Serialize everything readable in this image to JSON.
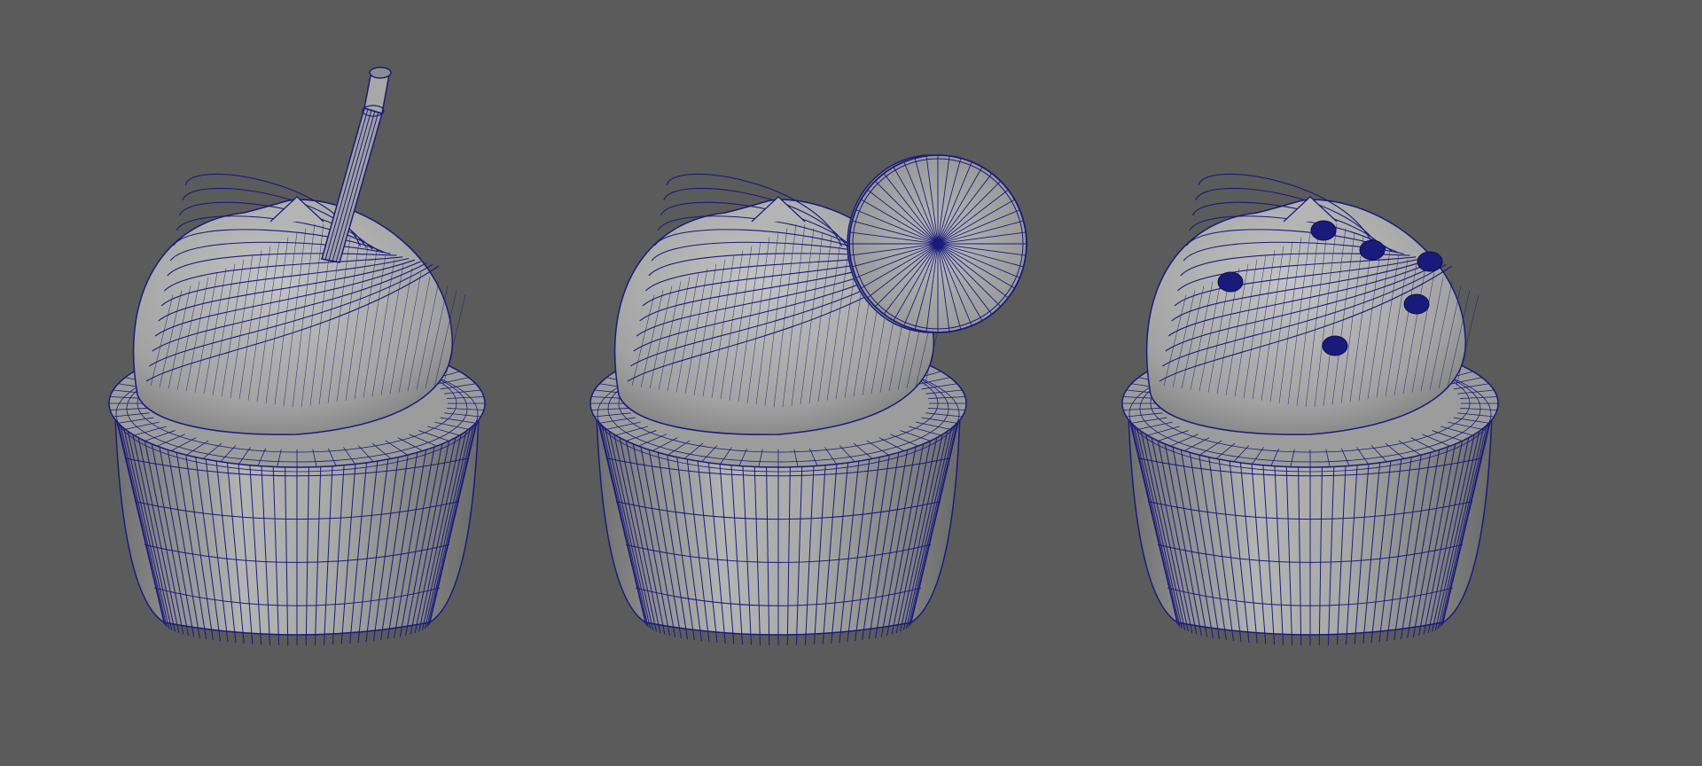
{
  "viewport": {
    "background_color": "#5b5b5b",
    "wire_color": "#1a1a7a",
    "surface_color": "#a6a6a6",
    "surface_shadow_color": "#7c7c7c",
    "shading_mode": "wireframe-on-shaded"
  },
  "objects": [
    {
      "name": "cupcake-with-straw",
      "topper": "straw"
    },
    {
      "name": "cupcake-with-lemon-slice",
      "topper": "lemon-slice"
    },
    {
      "name": "cupcake-with-sprinkles",
      "topper": "sprinkles"
    }
  ]
}
